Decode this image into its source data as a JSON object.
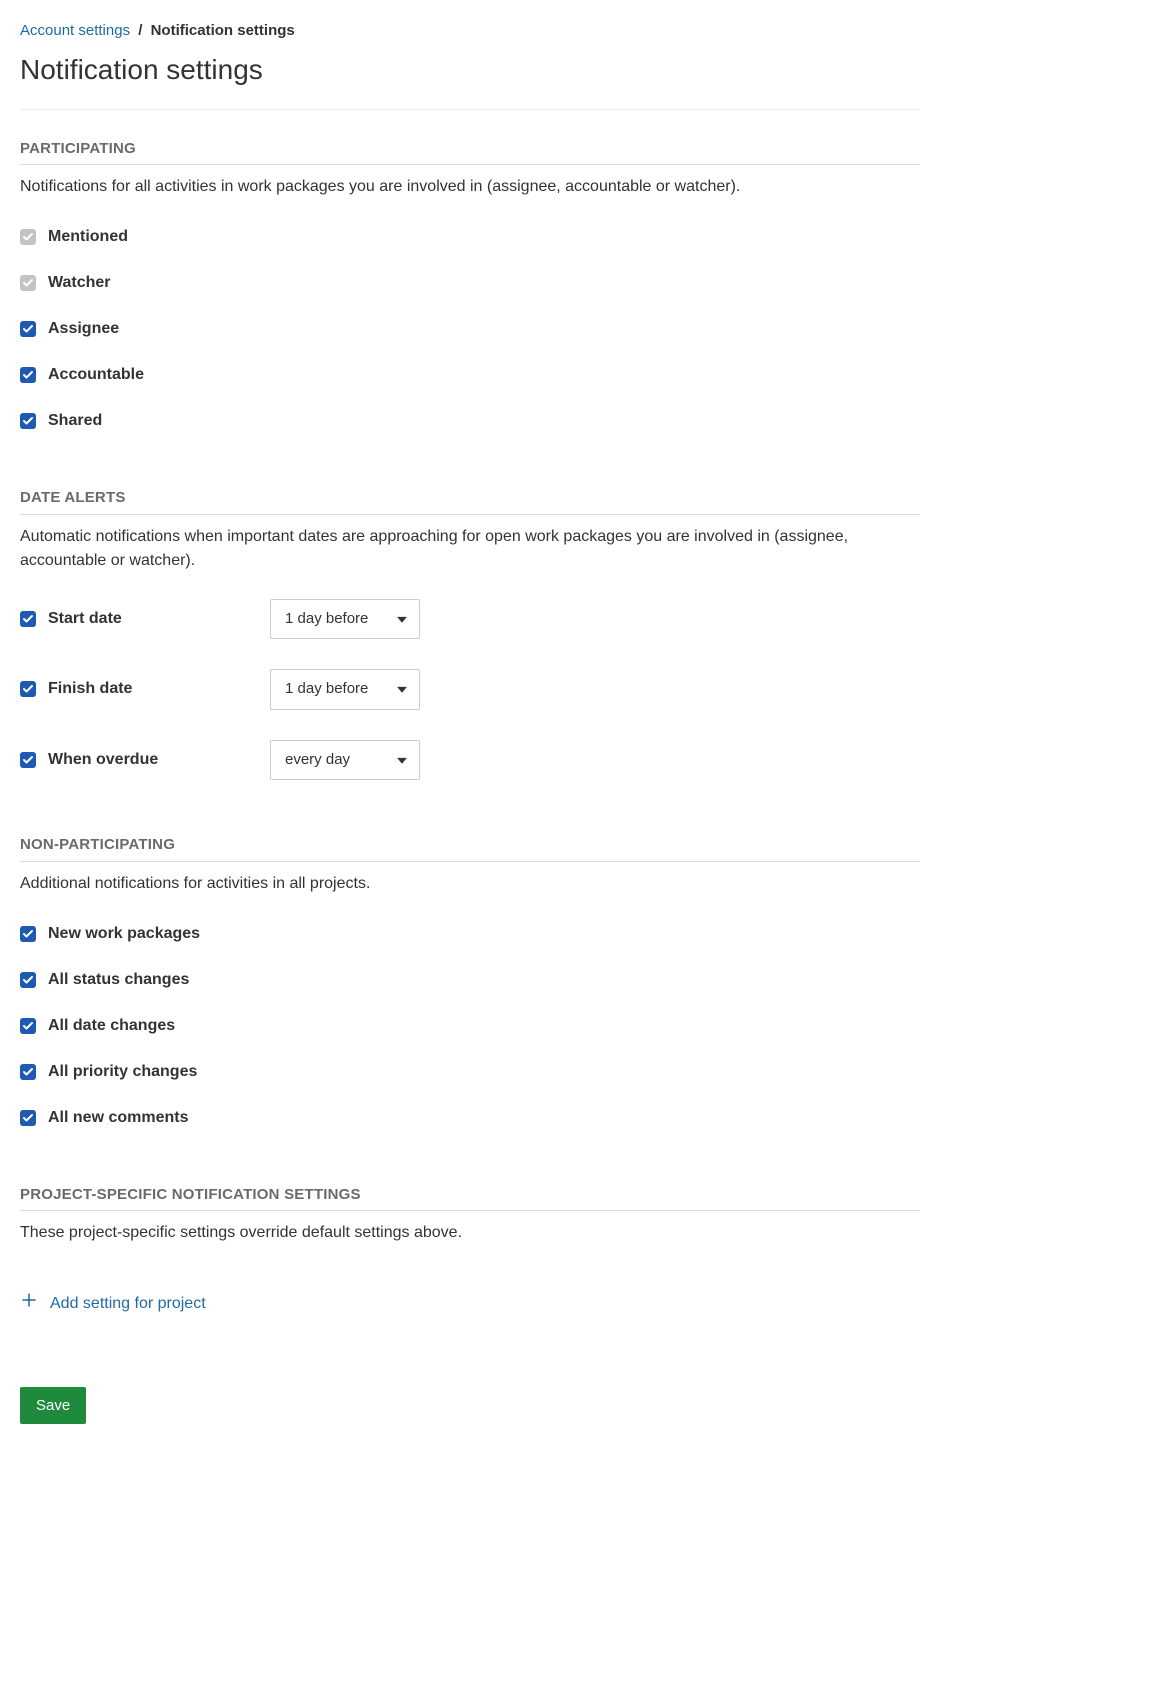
{
  "breadcrumb": {
    "parent": "Account settings",
    "current": "Notification settings"
  },
  "page_title": "Notification settings",
  "sections": {
    "participating": {
      "heading": "Participating",
      "desc": "Notifications for all activities in work packages you are involved in (assignee, accountable or watcher).",
      "items": [
        {
          "label": "Mentioned"
        },
        {
          "label": "Watcher"
        },
        {
          "label": "Assignee"
        },
        {
          "label": "Accountable"
        },
        {
          "label": "Shared"
        }
      ]
    },
    "date_alerts": {
      "heading": "Date alerts",
      "desc": "Automatic notifications when important dates are approaching for open work packages you are involved in (assignee, accountable or watcher).",
      "items": [
        {
          "label": "Start date",
          "select": "1 day before"
        },
        {
          "label": "Finish date",
          "select": "1 day before"
        },
        {
          "label": "When overdue",
          "select": "every day"
        }
      ]
    },
    "non_participating": {
      "heading": "Non-participating",
      "desc": "Additional notifications for activities in all projects.",
      "items": [
        {
          "label": "New work packages"
        },
        {
          "label": "All status changes"
        },
        {
          "label": "All date changes"
        },
        {
          "label": "All priority changes"
        },
        {
          "label": "All new comments"
        }
      ]
    },
    "project_specific": {
      "heading": "Project-specific notification settings",
      "desc": "These project-specific settings override default settings above.",
      "add_label": "Add setting for project"
    }
  },
  "save_label": "Save"
}
